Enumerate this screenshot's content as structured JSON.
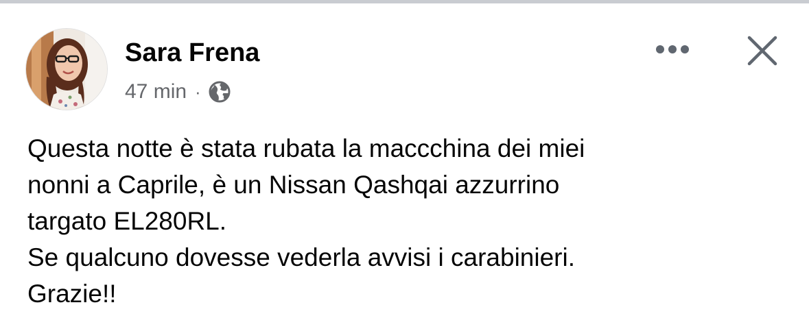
{
  "post": {
    "author": "Sara Frena",
    "time": "47 min",
    "separator": "·",
    "audience_icon": "globe-icon",
    "lines": [
      "Questa notte è stata rubata la maccchina dei miei",
      "nonni a Caprile, è un Nissan Qashqai azzurrino",
      "targato EL280RL.",
      "Se qualcuno dovesse vederla avvisi i carabinieri.",
      "Grazie!!"
    ]
  },
  "header_actions": {
    "more_icon": "more-horizontal-icon",
    "close_icon": "close-icon"
  },
  "colors": {
    "text_primary": "#050505",
    "text_secondary": "#65676b",
    "icon": "#606770",
    "divider": "#c9ccd1"
  }
}
